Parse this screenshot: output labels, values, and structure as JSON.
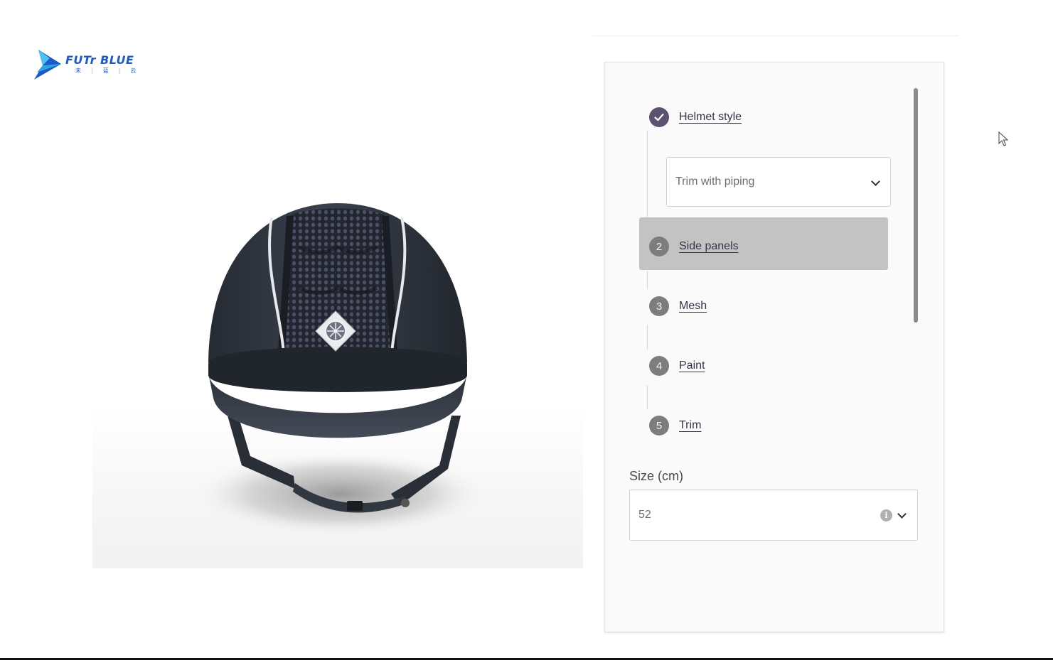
{
  "brand": {
    "name": "FUTr BLUE",
    "subtitle": [
      "未",
      "蓝",
      "云"
    ],
    "color": "#1c59c5"
  },
  "configurator": {
    "steps": [
      {
        "number": "",
        "status": "done",
        "label": "Helmet style"
      },
      {
        "number": "2",
        "status": "active",
        "label": "Side panels"
      },
      {
        "number": "3",
        "status": "pending",
        "label": "Mesh"
      },
      {
        "number": "4",
        "status": "pending",
        "label": "Paint"
      },
      {
        "number": "5",
        "status": "pending",
        "label": "Trim"
      }
    ],
    "helmet_style_select": {
      "value": "Trim with piping"
    },
    "size": {
      "label": "Size (cm)",
      "value": "52"
    }
  },
  "colors": {
    "accent": "#5c5270",
    "badge": "#7d7d7d",
    "highlight": "#c3c3c3",
    "helmet": "#2f3540",
    "mesh": "#3c4258"
  },
  "icons": {
    "step1": "check-icon",
    "select": "chevron-down-icon",
    "size_info": "info-icon",
    "pointer": "cursor-icon"
  }
}
